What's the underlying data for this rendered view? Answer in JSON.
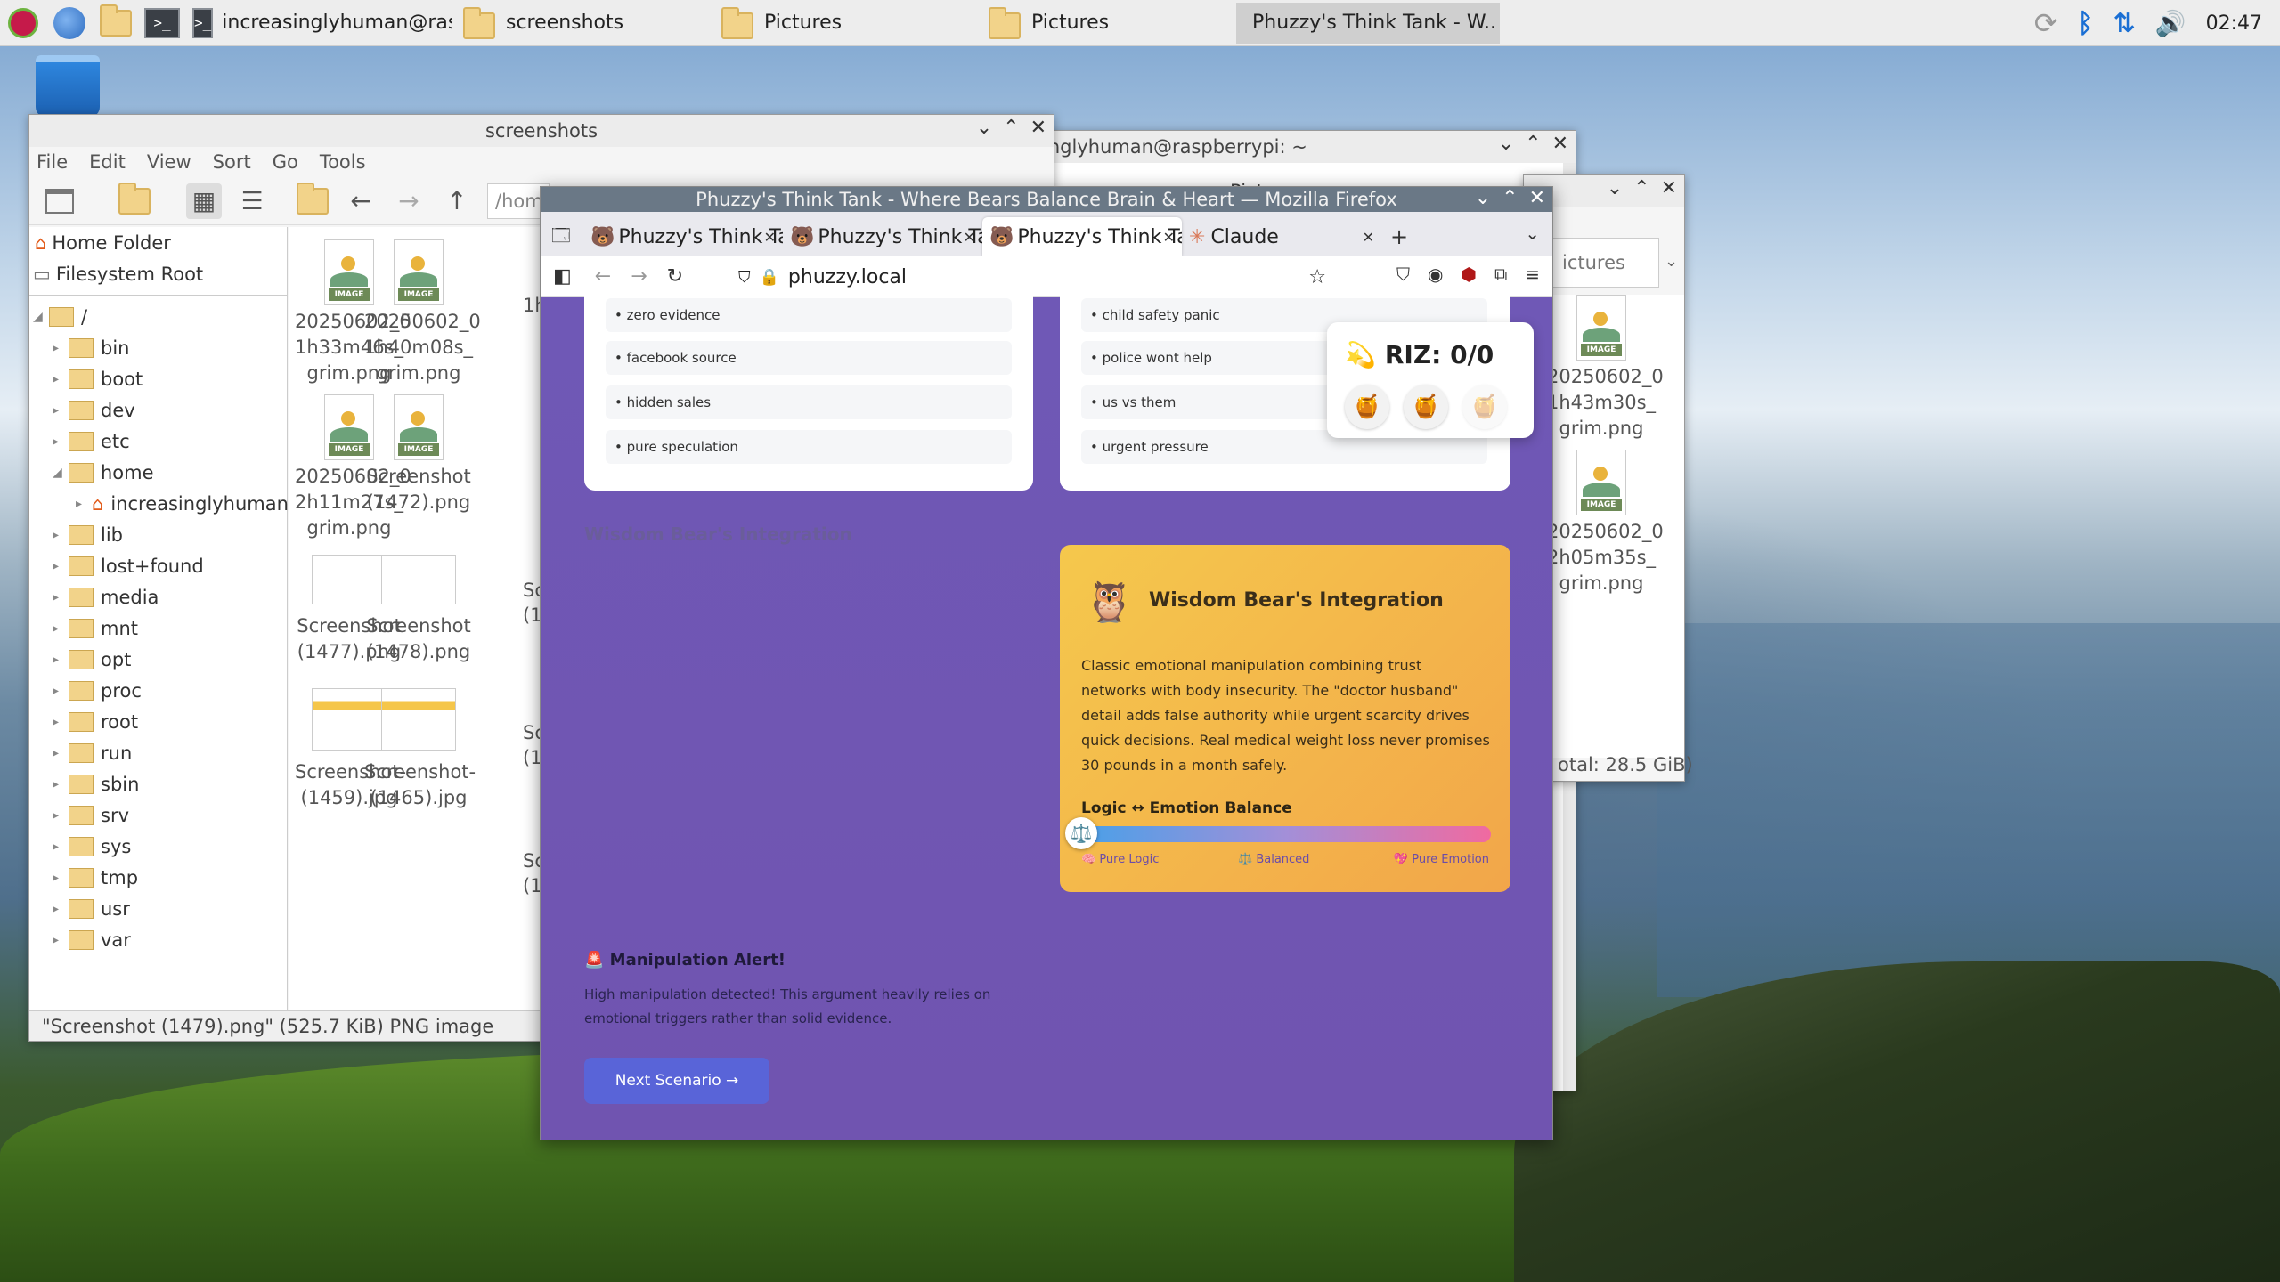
{
  "taskbar": {
    "terminal_label": "increasinglyhuman@ras..",
    "folder1_label": "screenshots",
    "folder2_label": "Pictures",
    "folder3_label": "Pictures",
    "firefox_label": "Phuzzy's Think Tank - W..",
    "clock": "02:47"
  },
  "fm": {
    "title": "screenshots",
    "menu": [
      "File",
      "Edit",
      "View",
      "Sort",
      "Go",
      "Tools"
    ],
    "path": "/hom",
    "places": [
      "Home Folder",
      "Filesystem Root"
    ],
    "tree_root": "/",
    "tree": [
      "bin",
      "boot",
      "dev",
      "etc",
      "home",
      "increasinglyhuman",
      "lib",
      "lost+found",
      "media",
      "mnt",
      "opt",
      "proc",
      "root",
      "run",
      "sbin",
      "srv",
      "sys",
      "tmp",
      "usr",
      "var"
    ],
    "files": [
      {
        "l1": "20250602_0",
        "l2": "1h33m46s_",
        "l3": "grim.png"
      },
      {
        "l1": "20250602_0",
        "l2": "1h40m08s_",
        "l3": "grim.png"
      },
      {
        "l1": "20250602_0",
        "l2": "2h11m27s_",
        "l3": "grim.png"
      },
      {
        "l1": "Screenshot",
        "l2": "(1472).png",
        "l3": ""
      },
      {
        "l1": "Screenshot",
        "l2": "(1477).png",
        "l3": ""
      },
      {
        "l1": "Screenshot",
        "l2": "(1478).png",
        "l3": ""
      },
      {
        "l1": "Screenshot-",
        "l2": "(1459).jpg",
        "l3": ""
      },
      {
        "l1": "Screenshot-",
        "l2": "(1465).jpg",
        "l3": ""
      }
    ],
    "partial_col": [
      "1h",
      "Sc",
      "(1",
      "Sc",
      "(1",
      "Sc",
      "(1"
    ],
    "status": "\"Screenshot (1479).png\" (525.7 KiB) PNG image"
  },
  "term_win": {
    "title": "inglyhuman@raspberrypi: ~"
  },
  "pics_win": {
    "title": "Pictures",
    "path": "ictures",
    "files": [
      {
        "l1": "20250602_0",
        "l2": "1h43m30s_",
        "l3": "grim.png"
      },
      {
        "l1": "20250602_0",
        "l2": "2h05m35s_",
        "l3": "grim.png"
      }
    ],
    "status": "otal: 28.5 GiB)"
  },
  "firefox": {
    "title": "Phuzzy's Think Tank - Where Bears Balance Brain & Heart — Mozilla Firefox",
    "tabs": [
      "Phuzzy's Think Ta",
      "Phuzzy's Think Ta",
      "Phuzzy's Think Ta",
      "Claude"
    ],
    "url": "phuzzy.local"
  },
  "page": {
    "left_items": [
      "• zero evidence",
      "• facebook source",
      "• hidden sales",
      "• pure speculation"
    ],
    "right_items": [
      "• child safety panic",
      "• police wont help",
      "• us vs them",
      "• urgent pressure"
    ],
    "riz": "RIZ: 0/0",
    "faded_heading": "Wisdom Bear's Integration",
    "wisdom_title": "Wisdom Bear's Integration",
    "wisdom_text": "Classic emotional manipulation combining trust networks with body insecurity. The \"doctor husband\" detail adds false authority while urgent scarcity drives quick decisions. Real medical weight loss never promises 30 pounds in a month safely.",
    "balance_label": "Logic ↔ Emotion Balance",
    "scale": [
      "🧠 Pure Logic",
      "⚖️ Balanced",
      "💖 Pure Emotion"
    ],
    "alert_title": "🚨 Manipulation Alert!",
    "alert_text": "High manipulation detected! This argument heavily relies on emotional triggers rather than solid evidence.",
    "next": "Next Scenario →"
  }
}
